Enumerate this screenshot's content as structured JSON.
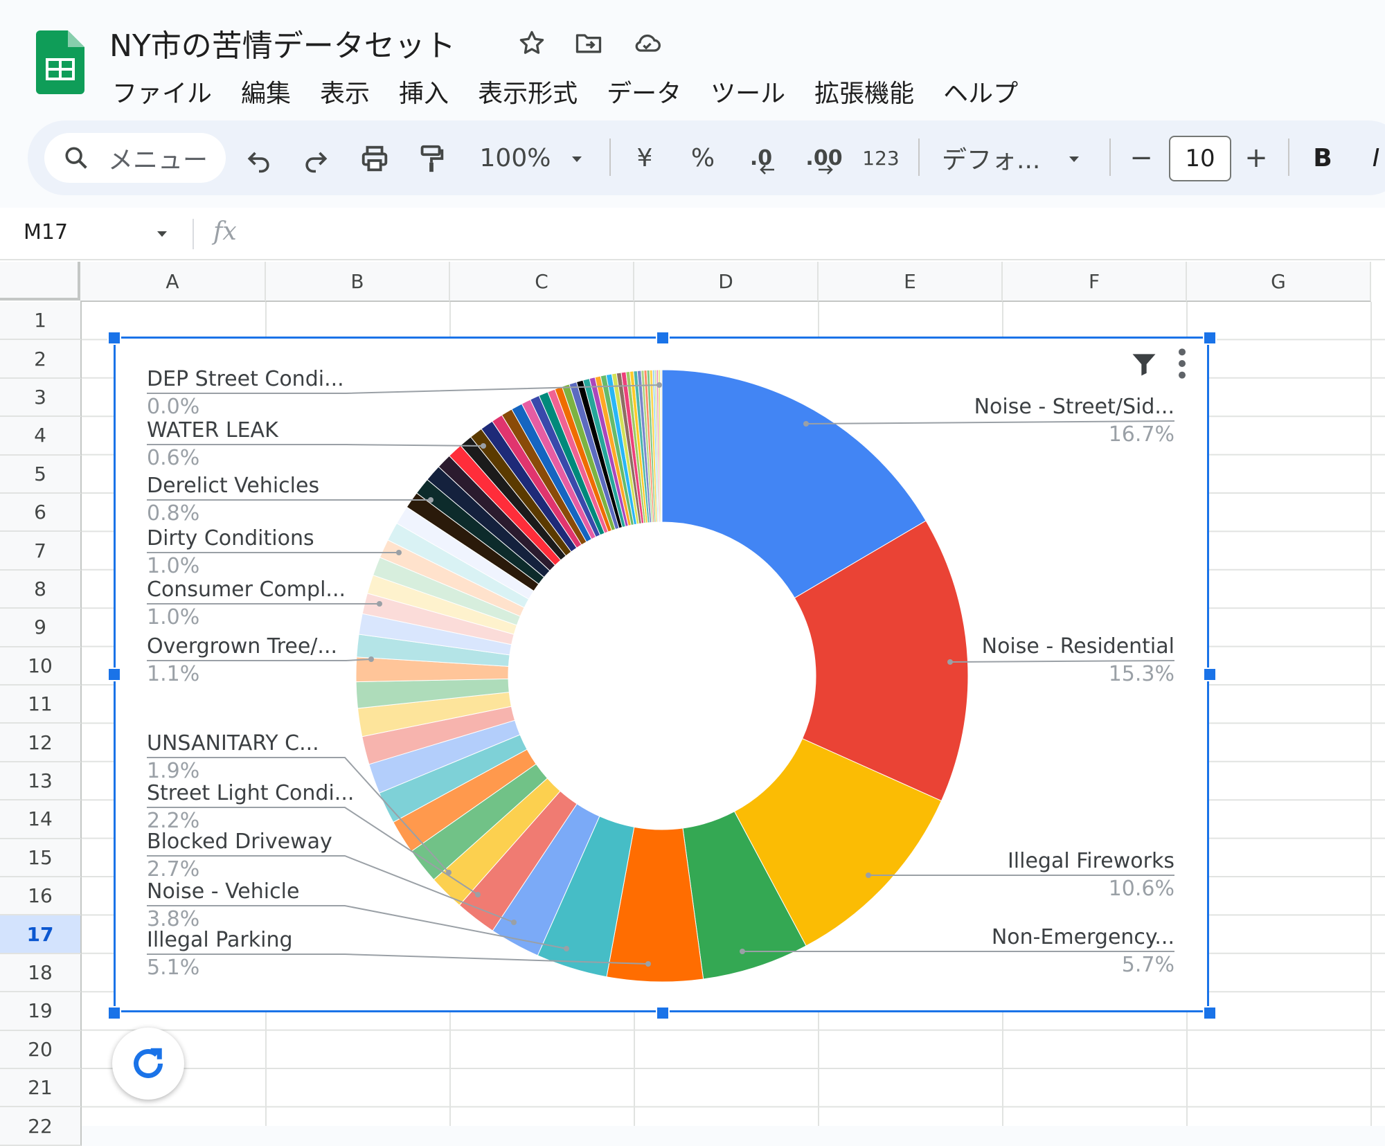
{
  "app": {
    "title": "NY市の苦情データセット",
    "icons": [
      "sheets-logo-icon",
      "star-icon",
      "move-folder-icon",
      "cloud-status-icon"
    ]
  },
  "menu": [
    "ファイル",
    "編集",
    "表示",
    "挿入",
    "表示形式",
    "データ",
    "ツール",
    "拡張機能",
    "ヘルプ"
  ],
  "toolbar": {
    "search_label": "メニュー",
    "zoom": "100%",
    "currency": "¥",
    "percent": "%",
    "decrease_decimal": ".0",
    "increase_decimal": ".00",
    "number_format": "123",
    "font": "デフォ...",
    "minus": "−",
    "font_size": "10",
    "plus": "+",
    "bold": "B",
    "italic": "I"
  },
  "formula_bar": {
    "cell_ref": "M17",
    "fx": "fx",
    "value": ""
  },
  "grid": {
    "columns": [
      "A",
      "B",
      "C",
      "D",
      "E",
      "F",
      "G"
    ],
    "rows": [
      "1",
      "2",
      "3",
      "4",
      "5",
      "6",
      "7",
      "8",
      "9",
      "10",
      "11",
      "12",
      "13",
      "14",
      "15",
      "16",
      "17",
      "18",
      "19",
      "20",
      "21",
      "22"
    ],
    "selected_row": "17"
  },
  "chart_data": {
    "type": "pie",
    "variant": "donut",
    "title": "",
    "labels_left": [
      {
        "name": "DEP Street Condi...",
        "value": "0.0%"
      },
      {
        "name": "WATER LEAK",
        "value": "0.6%"
      },
      {
        "name": "Derelict Vehicles",
        "value": "0.8%"
      },
      {
        "name": "Dirty Conditions",
        "value": "1.0%"
      },
      {
        "name": "Consumer Compl...",
        "value": "1.0%"
      },
      {
        "name": "Overgrown Tree/...",
        "value": "1.1%"
      },
      {
        "name": "UNSANITARY C...",
        "value": "1.9%"
      },
      {
        "name": "Street Light Condi...",
        "value": "2.2%"
      },
      {
        "name": "Blocked Driveway",
        "value": "2.7%"
      },
      {
        "name": "Noise - Vehicle",
        "value": "3.8%"
      },
      {
        "name": "Illegal Parking",
        "value": "5.1%"
      }
    ],
    "labels_right": [
      {
        "name": "Noise - Street/Sid...",
        "value": "16.7%"
      },
      {
        "name": "Noise - Residential",
        "value": "15.3%"
      },
      {
        "name": "Illegal Fireworks",
        "value": "10.6%"
      },
      {
        "name": "Non-Emergency...",
        "value": "5.7%"
      }
    ],
    "slices": [
      {
        "value": 16.7,
        "color": "#4285f4"
      },
      {
        "value": 15.3,
        "color": "#ea4335"
      },
      {
        "value": 10.6,
        "color": "#fbbc04"
      },
      {
        "value": 5.7,
        "color": "#34a853"
      },
      {
        "value": 5.1,
        "color": "#ff6d01"
      },
      {
        "value": 3.8,
        "color": "#46bdc6"
      },
      {
        "value": 2.7,
        "color": "#7baaf7"
      },
      {
        "value": 2.2,
        "color": "#f07b72"
      },
      {
        "value": 1.9,
        "color": "#fcd04f"
      },
      {
        "value": 1.9,
        "color": "#71c287"
      },
      {
        "value": 1.8,
        "color": "#ff994d"
      },
      {
        "value": 1.7,
        "color": "#7ed1d7"
      },
      {
        "value": 1.6,
        "color": "#b3cefb"
      },
      {
        "value": 1.5,
        "color": "#f7b4ae"
      },
      {
        "value": 1.5,
        "color": "#fde49b"
      },
      {
        "value": 1.4,
        "color": "#aedcba"
      },
      {
        "value": 1.3,
        "color": "#ffc599"
      },
      {
        "value": 1.2,
        "color": "#b4e4e7"
      },
      {
        "value": 1.1,
        "color": "#d9e6fd"
      },
      {
        "value": 1.1,
        "color": "#fbdcd9"
      },
      {
        "value": 1.0,
        "color": "#fef2cd"
      },
      {
        "value": 1.0,
        "color": "#d7eedd"
      },
      {
        "value": 1.0,
        "color": "#ffe2cc"
      },
      {
        "value": 1.0,
        "color": "#d9f2f4"
      },
      {
        "value": 1.0,
        "color": "#f0f4fe"
      },
      {
        "value": 0.9,
        "color": "#2a1a0a"
      },
      {
        "value": 0.9,
        "color": "#0d2b2b"
      },
      {
        "value": 0.9,
        "color": "#14213d"
      },
      {
        "value": 0.8,
        "color": "#2b1b2e"
      },
      {
        "value": 0.8,
        "color": "#ff2d3a"
      },
      {
        "value": 0.7,
        "color": "#1b1b1b"
      },
      {
        "value": 0.7,
        "color": "#5b3a00"
      },
      {
        "value": 0.7,
        "color": "#1e2a78"
      },
      {
        "value": 0.6,
        "color": "#e0356e"
      },
      {
        "value": 0.6,
        "color": "#8a4b08"
      },
      {
        "value": 0.6,
        "color": "#1565c0"
      },
      {
        "value": 0.5,
        "color": "#e65da3"
      },
      {
        "value": 0.5,
        "color": "#3949ab"
      },
      {
        "value": 0.5,
        "color": "#00897b"
      },
      {
        "value": 0.4,
        "color": "#f06292"
      },
      {
        "value": 0.4,
        "color": "#ef6c00"
      },
      {
        "value": 0.4,
        "color": "#7cb342"
      },
      {
        "value": 0.4,
        "color": "#5c6bc0"
      },
      {
        "value": 0.35,
        "color": "#000000"
      },
      {
        "value": 0.35,
        "color": "#26a69a"
      },
      {
        "value": 0.3,
        "color": "#ab47bc"
      },
      {
        "value": 0.3,
        "color": "#ffa726"
      },
      {
        "value": 0.3,
        "color": "#66bb6a"
      },
      {
        "value": 0.3,
        "color": "#29b6f6"
      },
      {
        "value": 0.25,
        "color": "#d4e157"
      },
      {
        "value": 0.25,
        "color": "#8d6e63"
      },
      {
        "value": 0.25,
        "color": "#ec407a"
      },
      {
        "value": 0.2,
        "color": "#9ccc65"
      },
      {
        "value": 0.2,
        "color": "#ffca28"
      },
      {
        "value": 0.2,
        "color": "#4db6ac"
      },
      {
        "value": 0.2,
        "color": "#7986cb"
      },
      {
        "value": 0.15,
        "color": "#aed581"
      },
      {
        "value": 0.15,
        "color": "#ff8a65"
      },
      {
        "value": 0.15,
        "color": "#81c784"
      },
      {
        "value": 0.15,
        "color": "#ffd54f"
      },
      {
        "value": 0.1,
        "color": "#90caf9"
      },
      {
        "value": 0.1,
        "color": "#c5e1a5"
      },
      {
        "value": 0.1,
        "color": "#f48fb1"
      },
      {
        "value": 0.1,
        "color": "#dce775"
      },
      {
        "value": 0.05,
        "color": "#b0bec5"
      },
      {
        "value": 0.05,
        "color": "#ffe082"
      }
    ]
  }
}
